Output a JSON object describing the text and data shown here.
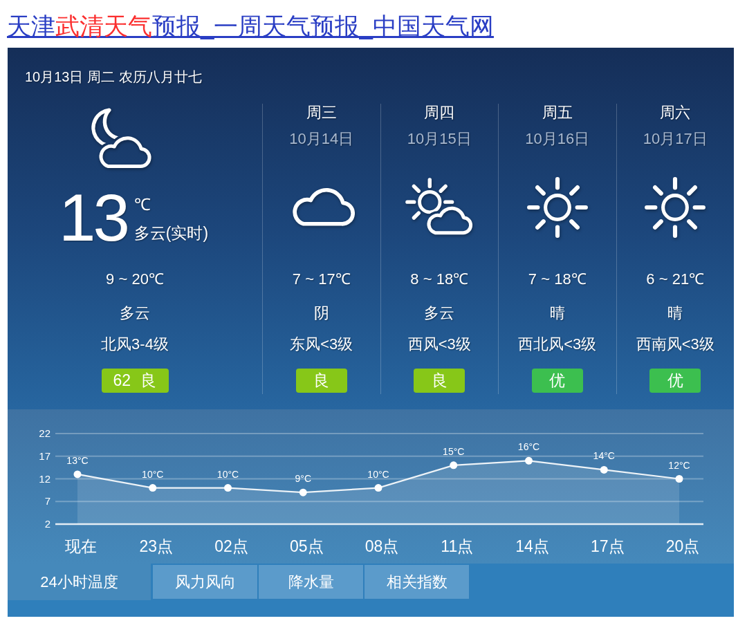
{
  "page_title": {
    "parts": [
      {
        "text": "天津",
        "kind": "plain"
      },
      {
        "text": "武清天气",
        "kind": "highlight"
      },
      {
        "text": "预报_一周天气预报_中国天气网",
        "kind": "plain"
      }
    ]
  },
  "today": {
    "date_line": "10月13日 周二 农历八月廿七",
    "kind": "partly-cloudy-night",
    "temperature": "13",
    "unit": "℃",
    "condition_now": "多云(实时)",
    "temp_range": "9 ~ 20℃",
    "weather": "多云",
    "wind": "北风3-4级",
    "aqi": {
      "label": "62 良",
      "color": "#87c718"
    }
  },
  "forecast": [
    {
      "day": "周三",
      "date": "10月14日",
      "kind": "overcast",
      "temp_range": "7 ~ 17℃",
      "weather": "阴",
      "wind": "东风<3级",
      "aqi": {
        "label": "良",
        "color": "#87c718"
      }
    },
    {
      "day": "周四",
      "date": "10月15日",
      "kind": "partly-cloudy",
      "temp_range": "8 ~ 18℃",
      "weather": "多云",
      "wind": "西风<3级",
      "aqi": {
        "label": "良",
        "color": "#87c718"
      }
    },
    {
      "day": "周五",
      "date": "10月16日",
      "kind": "sunny",
      "temp_range": "7 ~ 18℃",
      "weather": "晴",
      "wind": "西北风<3级",
      "aqi": {
        "label": "优",
        "color": "#3cbf4f"
      }
    },
    {
      "day": "周六",
      "date": "10月17日",
      "kind": "sunny",
      "temp_range": "6 ~ 21℃",
      "weather": "晴",
      "wind": "西南风<3级",
      "aqi": {
        "label": "优",
        "color": "#3cbf4f"
      }
    }
  ],
  "hourly_chart": {
    "chart_data": {
      "type": "area",
      "categories": [
        "现在",
        "23点",
        "02点",
        "05点",
        "08点",
        "11点",
        "14点",
        "17点",
        "20点"
      ],
      "series": [
        {
          "color": "#ffffff",
          "values": [
            13,
            10,
            10,
            9,
            10,
            15,
            16,
            14,
            12
          ]
        }
      ],
      "value_labels": [
        "13°C",
        "10°C",
        "10°C",
        "9°C",
        "10°C",
        "15°C",
        "16°C",
        "14°C",
        "12°C"
      ],
      "ylim": [
        2,
        22
      ],
      "yticks": [
        2,
        7,
        12,
        17,
        22
      ],
      "grid": true
    }
  },
  "tabs": [
    {
      "label": "24小时温度",
      "selected": true
    },
    {
      "label": "风力风向",
      "selected": false
    },
    {
      "label": "降水量",
      "selected": false
    },
    {
      "label": "相关指数",
      "selected": false
    }
  ]
}
